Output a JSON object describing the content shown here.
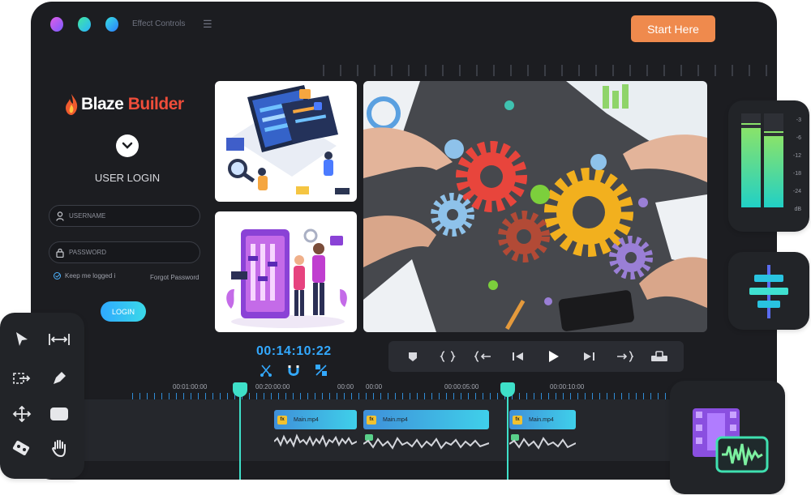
{
  "app": {
    "menu_title": "Effect Controls",
    "start_button": "Start Here"
  },
  "login": {
    "logo_part1": "Blaze",
    "logo_part2": "Builder",
    "title": "USER LOGIN",
    "username_placeholder": "USERNAME",
    "password_placeholder": "PASSWORD",
    "keep_logged": "Keep me logged i",
    "forgot": "Forgot Password",
    "button": "LOGIN"
  },
  "player": {
    "timecode": "00:14:10:22"
  },
  "timeline": {
    "labels": [
      "00:01:00:00",
      "00:20:00:00",
      "00:00",
      "00:00",
      "00:00:05:00",
      "00:00:10:00"
    ],
    "clips": [
      "Main.mp4",
      "Main.mp4",
      "Main.mp4"
    ],
    "clip_badge": "fx"
  },
  "meter": {
    "labels": [
      "-3",
      "-6",
      "-12",
      "-18",
      "-24",
      "dB"
    ]
  },
  "colors": {
    "accent": "#33a9ff",
    "start_button": "#ef8a4d",
    "playhead": "#3ee0c9",
    "clip": "#3fd0ea"
  }
}
